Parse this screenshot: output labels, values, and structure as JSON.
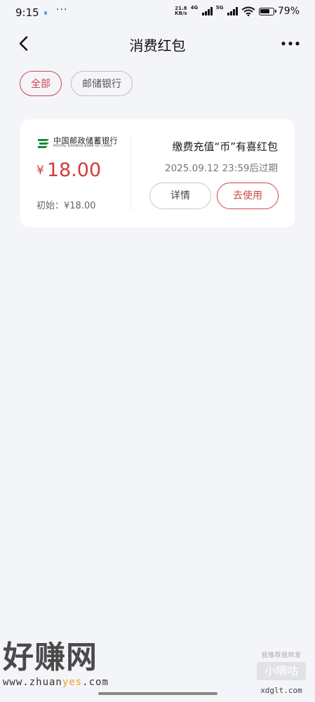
{
  "status_bar": {
    "time": "9:15",
    "more": "···",
    "net_speed_value": "21.8",
    "net_speed_unit": "KB/s",
    "signal_1_label": "4G",
    "signal_2_label": "5G",
    "battery_level": 0.79,
    "battery_text": "79%"
  },
  "nav": {
    "title": "消费红包",
    "back_icon": "chevron-left-icon",
    "more_icon": "more-dots-icon"
  },
  "filters": [
    {
      "label": "全部",
      "active": true
    },
    {
      "label": "邮储银行",
      "active": false
    }
  ],
  "coupon": {
    "bank_name_cn": "中国邮政储蓄银行",
    "bank_name_en": "POSTAL SAVINGS BANK OF CHINA",
    "currency_symbol": "¥",
    "amount": "18.00",
    "initial_text": "初始：¥18.00",
    "title": "缴费充值“币”有喜红包",
    "expiry": "2025.09.12 23:59后过期",
    "detail_label": "详情",
    "use_label": "去使用",
    "accent_color": "#d04549",
    "logo_color": "#1a8a3a"
  },
  "watermark": {
    "left_title": "好赚网",
    "left_url_pre": "www.zhuan",
    "left_url_hl": "yes",
    "left_url_post": ".com",
    "right_small": "我推荐我转发",
    "right_mid": "小嘀咕",
    "right_url": "xdglt.com"
  }
}
